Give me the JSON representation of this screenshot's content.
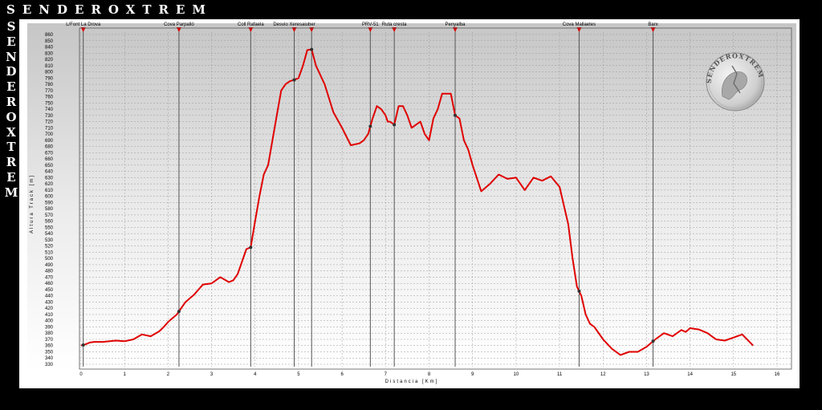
{
  "brand": {
    "title": "SENDEROXTREM",
    "logo_text": "SENDEROXTREM"
  },
  "chart_data": {
    "type": "line",
    "title": "",
    "xlabel": "Distancia [Km]",
    "ylabel": "Altura Track [m]",
    "xlim": [
      0,
      16
    ],
    "ylim": [
      330,
      860
    ],
    "x_ticks": [
      0,
      1,
      2,
      3,
      4,
      5,
      6,
      7,
      8,
      9,
      10,
      11,
      12,
      13,
      14,
      15,
      16
    ],
    "y_ticks": [
      330,
      340,
      350,
      360,
      370,
      380,
      390,
      400,
      410,
      420,
      430,
      440,
      450,
      460,
      470,
      480,
      490,
      500,
      510,
      520,
      530,
      540,
      550,
      560,
      570,
      580,
      590,
      600,
      610,
      620,
      630,
      640,
      650,
      660,
      670,
      680,
      690,
      700,
      710,
      720,
      730,
      740,
      750,
      760,
      770,
      780,
      790,
      800,
      810,
      820,
      830,
      840,
      850,
      860
    ],
    "grid": true,
    "line_color": "#e00000",
    "waypoint_color": "#e00000",
    "waypoints": [
      {
        "name": "L/Font La Drova",
        "x": 0.05
      },
      {
        "name": "Cova Parpalló",
        "x": 2.25
      },
      {
        "name": "Coll Rafaela",
        "x": 3.9
      },
      {
        "name": "Desvio Xeresaiuber",
        "x": 4.9
      },
      {
        "name": "",
        "x": 5.3
      },
      {
        "name": "PRV-51",
        "x": 6.65
      },
      {
        "name": "Ruta cresta",
        "x": 7.2
      },
      {
        "name": "Penyalba",
        "x": 8.6
      },
      {
        "name": "Cova Mallaetes",
        "x": 11.45
      },
      {
        "name": "Barx",
        "x": 13.15
      }
    ],
    "series": [
      {
        "x": [
          0.0,
          0.1,
          0.2,
          0.3,
          0.5,
          0.8,
          1.0,
          1.2,
          1.4,
          1.6,
          1.8,
          1.9,
          2.0,
          2.2,
          2.4,
          2.6,
          2.8,
          3.0,
          3.2,
          3.4,
          3.5,
          3.6,
          3.8,
          3.9,
          4.0,
          4.1,
          4.2,
          4.3,
          4.4,
          4.5,
          4.6,
          4.7,
          4.8,
          4.9,
          5.0,
          5.1,
          5.2,
          5.3,
          5.4,
          5.6,
          5.8,
          6.0,
          6.2,
          6.4,
          6.5,
          6.6,
          6.7,
          6.8,
          6.9,
          7.0,
          7.05,
          7.1,
          7.2,
          7.3,
          7.4,
          7.5,
          7.6,
          7.8,
          7.9,
          8.0,
          8.1,
          8.2,
          8.3,
          8.4,
          8.5,
          8.6,
          8.7,
          8.8,
          8.9,
          9.0,
          9.2,
          9.4,
          9.6,
          9.8,
          10.0,
          10.2,
          10.4,
          10.6,
          10.8,
          11.0,
          11.2,
          11.3,
          11.4,
          11.5,
          11.6,
          11.7,
          11.8,
          12.0,
          12.2,
          12.4,
          12.6,
          12.8,
          13.0,
          13.2,
          13.4,
          13.6,
          13.8,
          13.9,
          14.0,
          14.2,
          14.4,
          14.6,
          14.8,
          15.0,
          15.2,
          15.45
        ],
        "values": [
          360,
          362,
          365,
          366,
          366,
          368,
          367,
          370,
          378,
          375,
          383,
          390,
          398,
          410,
          430,
          442,
          458,
          460,
          470,
          462,
          465,
          475,
          515,
          518,
          560,
          600,
          635,
          650,
          690,
          730,
          770,
          780,
          785,
          787,
          790,
          810,
          835,
          836,
          810,
          780,
          735,
          710,
          682,
          685,
          690,
          700,
          725,
          745,
          740,
          730,
          720,
          720,
          715,
          745,
          745,
          730,
          710,
          720,
          700,
          690,
          725,
          740,
          765,
          765,
          765,
          730,
          725,
          690,
          675,
          650,
          608,
          620,
          635,
          628,
          630,
          610,
          630,
          625,
          632,
          615,
          555,
          500,
          455,
          440,
          410,
          395,
          390,
          370,
          355,
          345,
          350,
          350,
          358,
          370,
          380,
          375,
          385,
          382,
          388,
          386,
          380,
          370,
          368,
          373,
          378,
          360
        ]
      }
    ]
  }
}
